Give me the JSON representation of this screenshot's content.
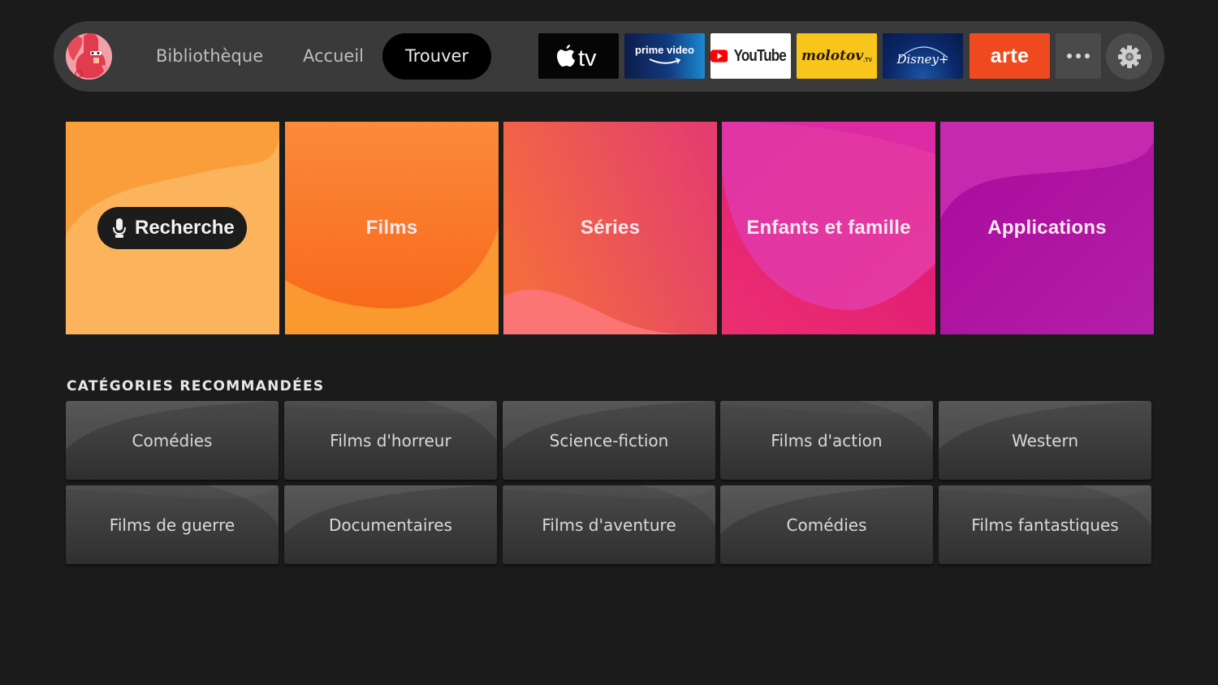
{
  "nav": {
    "avatar_icon": "profile-avatar-red-character",
    "links": [
      {
        "label": "Bibliothèque",
        "active": false
      },
      {
        "label": "Accueil",
        "active": false
      },
      {
        "label": "Trouver",
        "active": true
      }
    ],
    "apps": [
      {
        "name": "Apple TV",
        "label": "tv",
        "color": "#050505"
      },
      {
        "name": "Prime Video",
        "label": "prime video",
        "color": "#123a7d"
      },
      {
        "name": "YouTube",
        "label": "YouTube",
        "color": "#ffffff"
      },
      {
        "name": "Molotov",
        "label": "molotov",
        "sub": ".TV",
        "color": "#f8c51a"
      },
      {
        "name": "Disney+",
        "label": "Disney+",
        "color": "#0b2768"
      },
      {
        "name": "arte",
        "label": "arte",
        "color": "#ef4a1f"
      }
    ],
    "more_icon": "more-dots-icon",
    "settings_icon": "gear-icon"
  },
  "tiles": [
    {
      "label": "Recherche",
      "icon": "microphone-icon",
      "color": "#fbb157"
    },
    {
      "label": "Films",
      "color": "#f98a2c"
    },
    {
      "label": "Séries",
      "color": "#ec5565"
    },
    {
      "label": "Enfants et famille",
      "color": "#e6309a"
    },
    {
      "label": "Applications",
      "color": "#b310a6"
    }
  ],
  "recommended": {
    "title": "CATÉGORIES RECOMMANDÉES",
    "rows": [
      [
        "Comédies",
        "Films d'horreur",
        "Science-fiction",
        "Films d'action",
        "Western"
      ],
      [
        "Films de guerre",
        "Documentaires",
        "Films d'aventure",
        "Comédies",
        "Films fantastiques"
      ]
    ]
  }
}
